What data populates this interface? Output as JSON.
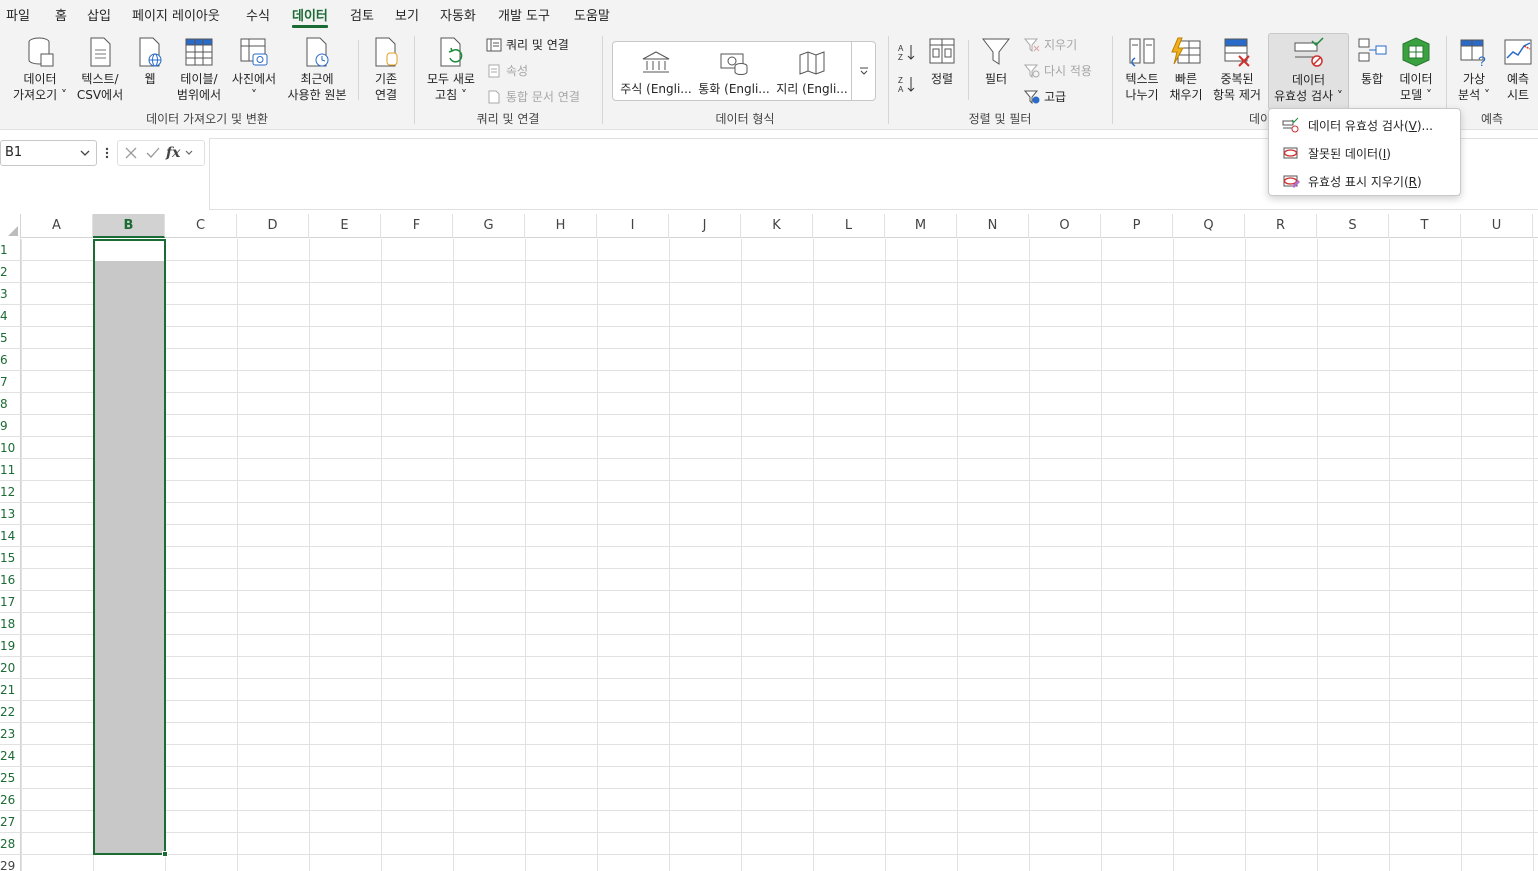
{
  "tabs": [
    "파일",
    "홈",
    "삽입",
    "페이지 레이아웃",
    "수식",
    "데이터",
    "검토",
    "보기",
    "자동화",
    "개발 도구",
    "도움말"
  ],
  "ribbon": {
    "get_data": {
      "line1": "데이터",
      "line2": "가져오기 ˅"
    },
    "text_csv": {
      "line1": "텍스트/",
      "line2": "CSV에서"
    },
    "web": {
      "line1": "웹"
    },
    "table_range": {
      "line1": "테이블/",
      "line2": "범위에서"
    },
    "from_picture": {
      "line1": "사진에서",
      "line2": "˅"
    },
    "recent_sources": {
      "line1": "최근에",
      "line2": "사용한 원본"
    },
    "existing_conn": {
      "line1": "기존",
      "line2": "연결"
    },
    "group_get_transform": "데이터 가져오기 및 변환",
    "refresh_all": {
      "line1": "모두 새로",
      "line2": "고침 ˅"
    },
    "queries_conn": "쿼리 및 연결",
    "properties": "속성",
    "edit_links": "통합 문서 연결",
    "group_queries": "쿼리 및 연결",
    "stocks": "주식 (Engli...",
    "currencies": "통화 (Engli...",
    "geography": "지리 (Engli...",
    "group_data_types": "데이터 형식",
    "sort": "정렬",
    "filter": "필터",
    "clear": "지우기",
    "reapply": "다시 적용",
    "advanced": "고급",
    "group_sort_filter": "정렬 및 필터",
    "text_to_columns": {
      "line1": "텍스트",
      "line2": "나누기"
    },
    "flash_fill": {
      "line1": "빠른",
      "line2": "채우기"
    },
    "remove_dupes": {
      "line1": "중복된",
      "line2": "항목 제거"
    },
    "data_validation": {
      "line1": "데이터",
      "line2": "유효성 검사 ˅"
    },
    "consolidate": "통합",
    "data_model": {
      "line1": "데이터",
      "line2": "모델 ˅"
    },
    "group_data_tools": "데이",
    "what_if": {
      "line1": "가상",
      "line2": "분석 ˅"
    },
    "forecast_sheet": {
      "line1": "예측",
      "line2": "시트"
    },
    "group_forecast": "예측"
  },
  "namebox": "B1",
  "fx": "fx",
  "columns": [
    "A",
    "B",
    "C",
    "D",
    "E",
    "F",
    "G",
    "H",
    "I",
    "J",
    "K",
    "L",
    "M",
    "N",
    "O",
    "P",
    "Q",
    "R",
    "S",
    "T",
    "U"
  ],
  "rows": [
    "1",
    "2",
    "3",
    "4",
    "5",
    "6",
    "7",
    "8",
    "9",
    "10",
    "11",
    "12",
    "13",
    "14",
    "15",
    "16",
    "17",
    "18",
    "19",
    "20",
    "21",
    "22",
    "23",
    "24",
    "25",
    "26",
    "27",
    "28",
    "29"
  ],
  "dropdown": {
    "item1": {
      "label": "데이터 유효성 검사(",
      "key": "V",
      "suffix": ")..."
    },
    "item2": {
      "label": "잘못된 데이터(",
      "key": "I",
      "suffix": ")"
    },
    "item3": {
      "label": "유효성 표시 지우기(",
      "key": "R",
      "suffix": ")"
    }
  },
  "colors": {
    "accent": "#1b6b35",
    "selection": "#c8c8c8",
    "ribbon_bg": "#f3f3f3"
  }
}
